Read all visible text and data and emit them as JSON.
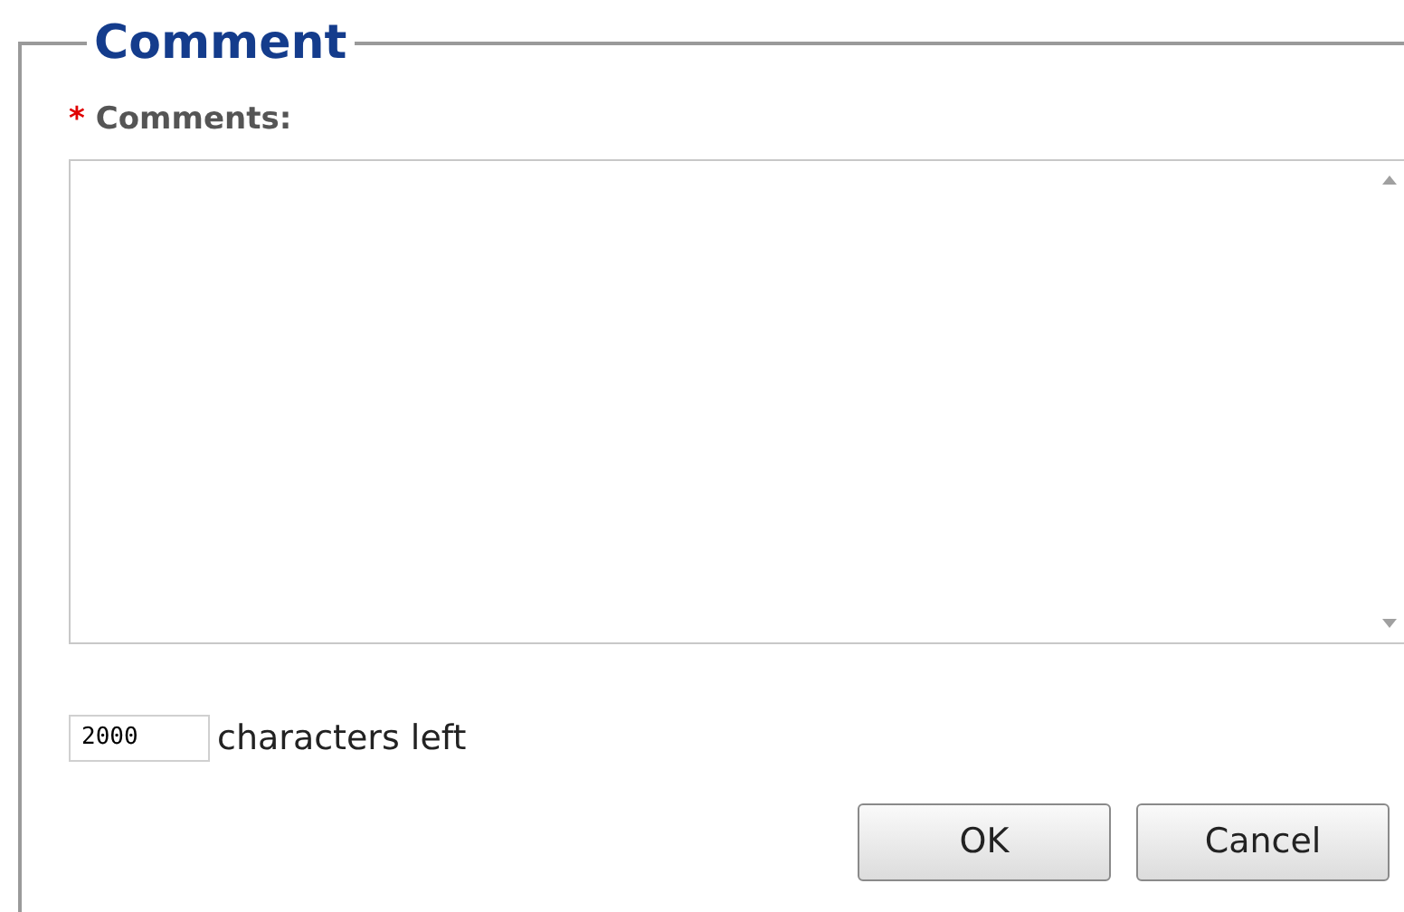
{
  "fieldset": {
    "legend": "Comment"
  },
  "comments_field": {
    "label": "Comments:",
    "required": true,
    "required_mark": "*"
  },
  "counter": {
    "value": "2000",
    "label": "characters left"
  },
  "buttons": [
    "OK",
    "Cancel"
  ]
}
